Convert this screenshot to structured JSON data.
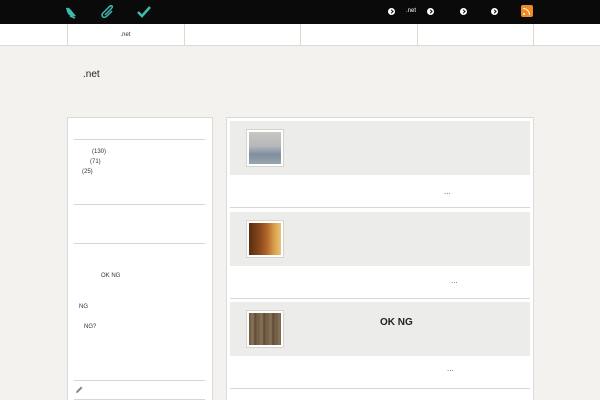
{
  "topbar": {
    "icons": [
      "bird-icon",
      "paperclip-icon",
      "checkmark-icon"
    ],
    "link_label": ".net",
    "nav_dots": [
      "arrow-right-icon",
      "arrow-right-icon",
      "arrow-right-icon",
      "arrow-right-icon"
    ],
    "rss": "rss-icon"
  },
  "nav": {
    "items": [
      ".net",
      "",
      "",
      "",
      ""
    ]
  },
  "site": {
    "title": ".net"
  },
  "sidebar": {
    "counts": [
      "(130)",
      "(71)",
      "(25)"
    ],
    "text_ok_ng": "OK NG",
    "text_ng": "NG",
    "text_ng_q": "NG?"
  },
  "posts": [
    {
      "title": "",
      "more": "..."
    },
    {
      "title": "",
      "more": "..."
    },
    {
      "title": "OK  NG",
      "more": "..."
    }
  ],
  "colors": {
    "accent": "#3fb9b0",
    "rss": "#f08a24",
    "topbar": "#0a0a0a",
    "background": "#f4f2ee"
  }
}
